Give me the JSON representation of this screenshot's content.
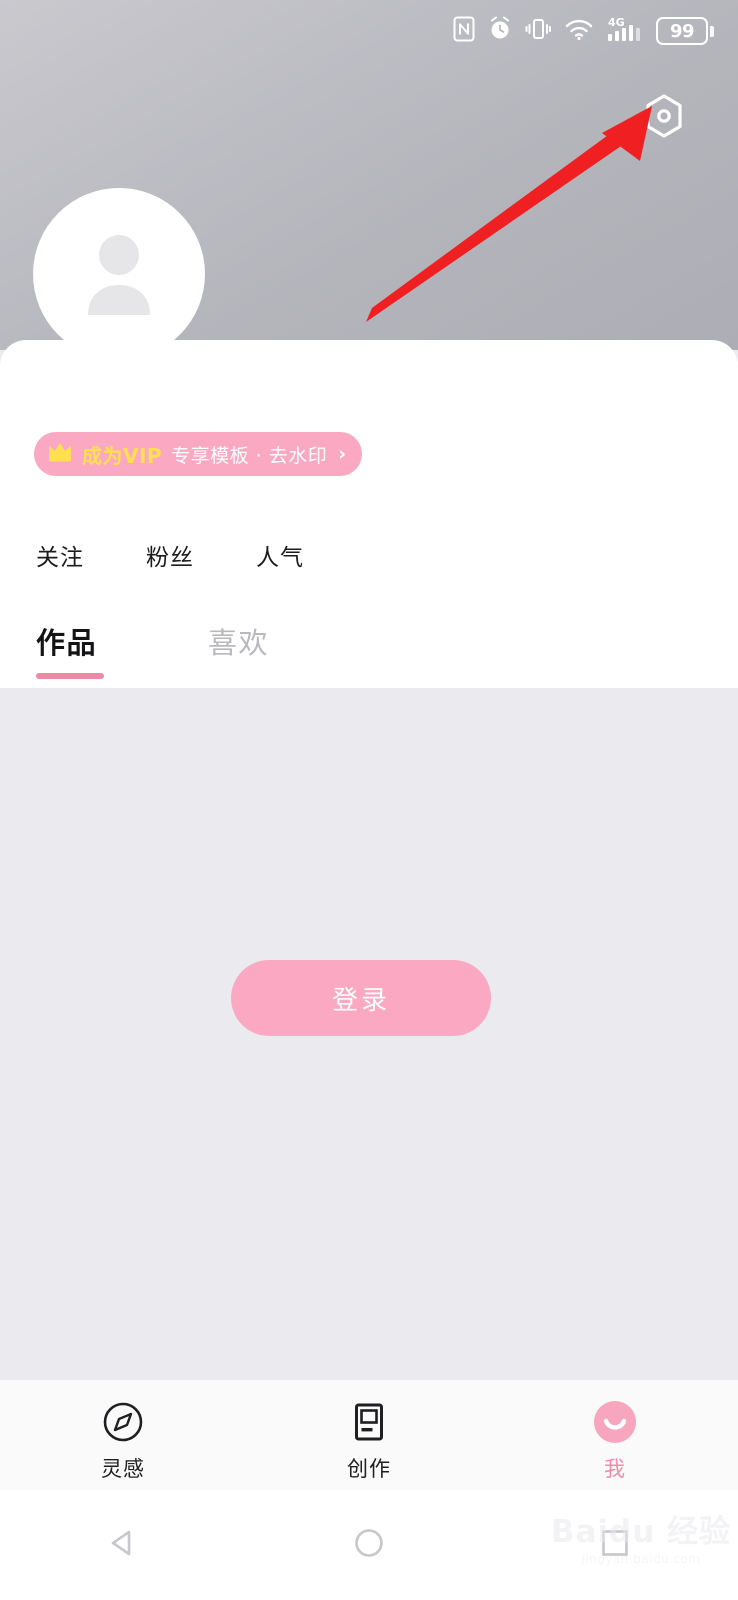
{
  "statusbar": {
    "icons": [
      "nfc-icon",
      "alarm-icon",
      "vibrate-icon",
      "wifi-icon",
      "signal-4g-icon"
    ],
    "network_label": "4G",
    "battery_level": "99"
  },
  "header": {
    "settings_icon": "settings-gear-icon",
    "avatar_icon": "default-avatar-icon",
    "annotation_arrow": "red-arrow-annotation"
  },
  "vip_banner": {
    "crown_icon": "crown-icon",
    "title": "成为VIP",
    "subtitle": "专享模板 · 去水印",
    "chevron": "›",
    "bg_color": "#fba9c2",
    "title_color": "#ffe14d"
  },
  "stats": [
    {
      "label": "关注"
    },
    {
      "label": "粉丝"
    },
    {
      "label": "人气"
    }
  ],
  "tabs": [
    {
      "label": "作品",
      "active": true
    },
    {
      "label": "喜欢",
      "active": false
    }
  ],
  "content": {
    "login_button": "登录",
    "login_color": "#fba9c2",
    "background_color": "#ebebef"
  },
  "bottom_nav": [
    {
      "label": "灵感",
      "icon": "compass-icon",
      "active": false
    },
    {
      "label": "创作",
      "icon": "create-document-icon",
      "active": false
    },
    {
      "label": "我",
      "icon": "profile-smile-icon",
      "active": true
    }
  ],
  "android_nav": [
    {
      "icon": "back-triangle-icon"
    },
    {
      "icon": "home-circle-icon"
    },
    {
      "icon": "recents-square-icon"
    }
  ],
  "watermark": {
    "main": "Baidu 经验",
    "sub": "jingyan.baidu.com"
  },
  "accent_color": "#ee8aa5"
}
